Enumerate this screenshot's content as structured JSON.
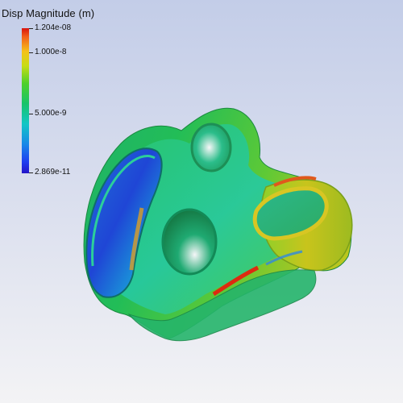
{
  "legend": {
    "title": "Disp Magnitude (m)",
    "max_label": "1.204e-08",
    "label_1": "1.000e-8",
    "label_2": "5.000e-9",
    "min_label": "2.869e-11"
  },
  "colors": {
    "background_top": "#c3cde8",
    "background_bottom": "#f3f3f5",
    "high": "#d9140d",
    "mid": "#4fd02a",
    "low": "#2414c8"
  }
}
